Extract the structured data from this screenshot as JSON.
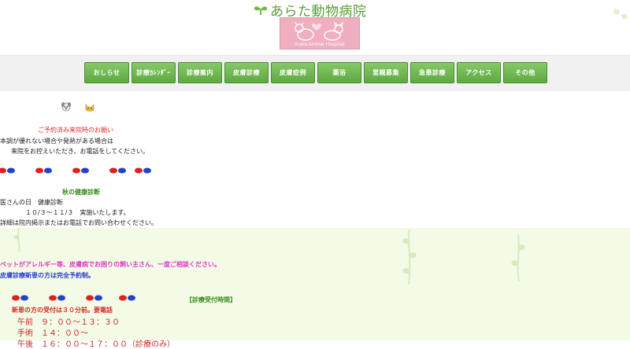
{
  "header": {
    "site_title": "あらた動物病院",
    "logo_caption": "Arata Animal Hospital"
  },
  "nav": {
    "items": [
      {
        "label": "おしらせ",
        "w": 57
      },
      {
        "label": "診療ｶﾚﾝﾀﾞｰ",
        "w": 56
      },
      {
        "label": "診療案内",
        "w": 56
      },
      {
        "label": "皮膚診療",
        "w": 56
      },
      {
        "label": "皮膚症例",
        "w": 56
      },
      {
        "label": "薬浴",
        "w": 56
      },
      {
        "label": "里親募集",
        "w": 56
      },
      {
        "label": "急患診療",
        "w": 56
      },
      {
        "label": "アクセス",
        "w": 56
      },
      {
        "label": "その他",
        "w": 56
      }
    ]
  },
  "notice": {
    "title": "ご予約済み来院時のお願い",
    "line1": "本調が優れない場合や発熱がある場合は",
    "line2": "来院をお控えいただき、お電話をしてください。"
  },
  "checkup": {
    "title": "秋の健康診断",
    "line1": "医さんの日　健康診断",
    "line2": "１０/３～１１/３　実施いたします。",
    "line3": "詳細は院内掲示またはお電話でお問い合わせください。"
  },
  "lower": {
    "allergy": "ペットがアレルギー等、皮膚病でお困りの飼い主さん、一度ご相談ください。",
    "reservation": "皮膚診療新患の方は完全予約制。",
    "hours_title": "【診療受付時間】",
    "new_patient": "新患の方の受付は３０分前。要電話",
    "morning": "午前　９：００～１３：３０",
    "surgery": "手術　１４：００～",
    "evening": "午後　１６：００～１７：００（診療のみ）"
  },
  "colors": {
    "nav_green": "#6db94f",
    "title_green": "#5a9e35",
    "logo_pink": "#efafc0",
    "lower_bg": "#f3fae5"
  }
}
